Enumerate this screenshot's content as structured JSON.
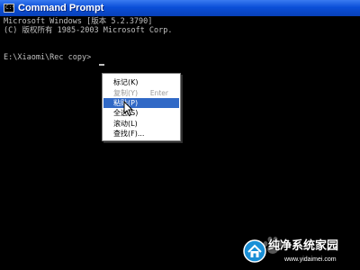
{
  "window": {
    "title": "Command Prompt",
    "icon": "console-icon",
    "icon_glyph": "C:\\"
  },
  "console": {
    "lines": [
      "Microsoft Windows [版本 5.2.3790]",
      "(C) 版权所有 1985-2003 Microsoft Corp.",
      "",
      "E:\\Xiaomi\\Rec copy>"
    ]
  },
  "context_menu": {
    "items": [
      {
        "label": "标记(K)",
        "state": "enabled"
      },
      {
        "label": "复制(Y)",
        "shortcut": "Enter",
        "state": "disabled"
      },
      {
        "label": "粘贴(P)",
        "state": "selected"
      },
      {
        "label": "全选(S)",
        "state": "enabled"
      },
      {
        "label": "滚动(L)",
        "state": "enabled"
      },
      {
        "label": "查找(F)...",
        "state": "enabled"
      }
    ]
  },
  "watermark": {
    "title": "纯净系统家园",
    "url": "www.yidaimei.com"
  },
  "colors": {
    "titlebar": "#0a4fd8",
    "console_bg": "#000000",
    "console_text": "#c0c0c0",
    "menu_highlight": "#3169c6"
  }
}
